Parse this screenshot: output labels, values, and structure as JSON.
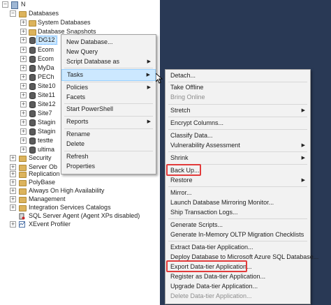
{
  "tree": {
    "root_label": "N",
    "databases_label": "Databases",
    "nodes": [
      {
        "label": "System Databases"
      },
      {
        "label": "Database Snapshots"
      },
      {
        "label": "DG12"
      },
      {
        "label": "Ecom"
      },
      {
        "label": "Ecom"
      },
      {
        "label": "MyDa"
      },
      {
        "label": "PECh"
      },
      {
        "label": "Site10"
      },
      {
        "label": "Site11"
      },
      {
        "label": "Site12"
      },
      {
        "label": "Site7"
      },
      {
        "label": "Stagin"
      },
      {
        "label": "Stagin"
      },
      {
        "label": "testte"
      },
      {
        "label": "ultima"
      }
    ],
    "top_nodes": [
      {
        "label": "Security"
      },
      {
        "label": "Server Ob"
      },
      {
        "label": "Replication"
      },
      {
        "label": "PolyBase"
      },
      {
        "label": "Always On High Availability"
      },
      {
        "label": "Management"
      },
      {
        "label": "Integration Services Catalogs"
      },
      {
        "label": "SQL Server Agent (Agent XPs disabled)"
      },
      {
        "label": "XEvent Profiler"
      }
    ]
  },
  "context_menu": {
    "items": [
      {
        "label": "New Database..."
      },
      {
        "label": "New Query"
      },
      {
        "label": "Script Database as"
      },
      {
        "label": "Tasks"
      },
      {
        "label": "Policies"
      },
      {
        "label": "Facets"
      },
      {
        "label": "Start PowerShell"
      },
      {
        "label": "Reports"
      },
      {
        "label": "Rename"
      },
      {
        "label": "Delete"
      },
      {
        "label": "Refresh"
      },
      {
        "label": "Properties"
      }
    ]
  },
  "tasks_menu": {
    "items": [
      {
        "label": "Detach..."
      },
      {
        "label": "Take Offline"
      },
      {
        "label": "Bring Online"
      },
      {
        "label": "Stretch"
      },
      {
        "label": "Encrypt Columns..."
      },
      {
        "label": "Classify Data..."
      },
      {
        "label": "Vulnerability Assessment"
      },
      {
        "label": "Shrink"
      },
      {
        "label": "Back Up..."
      },
      {
        "label": "Restore"
      },
      {
        "label": "Mirror..."
      },
      {
        "label": "Launch Database Mirroring Monitor..."
      },
      {
        "label": "Ship Transaction Logs..."
      },
      {
        "label": "Generate Scripts..."
      },
      {
        "label": "Generate In-Memory OLTP Migration Checklists"
      },
      {
        "label": "Extract Data-tier Application..."
      },
      {
        "label": "Deploy Database to Microsoft Azure SQL Database..."
      },
      {
        "label": "Export Data-tier Application..."
      },
      {
        "label": "Register as Data-tier Application..."
      },
      {
        "label": "Upgrade Data-tier Application..."
      },
      {
        "label": "Delete Data-tier Application..."
      }
    ]
  },
  "icons": {
    "expand": "plus-icon",
    "collapse": "minus-icon",
    "submenu": "chevron-right-icon",
    "folder": "folder-icon",
    "database": "database-icon",
    "server": "server-icon",
    "agent": "sql-agent-icon",
    "profiler": "xevent-profiler-icon",
    "cursor": "mouse-pointer-icon"
  },
  "colors": {
    "background_panel": "#293955",
    "menu_background": "#f2f2f2",
    "highlight": "#cce8ff",
    "highlight_border": "#99d1ff",
    "callout_border": "#e23b3b"
  }
}
